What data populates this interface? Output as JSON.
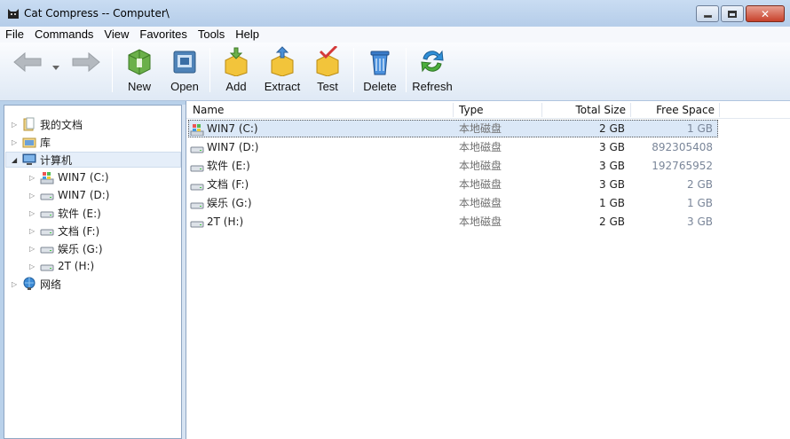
{
  "window": {
    "title": "Cat Compress -- Computer\\",
    "icons": {
      "app": "cat-icon",
      "minimize": "minimize-icon",
      "maximize": "maximize-icon",
      "close": "close-icon"
    }
  },
  "menu": [
    "File",
    "Commands",
    "View",
    "Favorites",
    "Tools",
    "Help"
  ],
  "toolbar": {
    "new_label": "New",
    "open_label": "Open",
    "add_label": "Add",
    "extract_label": "Extract",
    "test_label": "Test",
    "delete_label": "Delete",
    "refresh_label": "Refresh"
  },
  "tree": [
    {
      "label": "我的文档",
      "icon": "documents-folder-icon"
    },
    {
      "label": "库",
      "icon": "library-icon"
    },
    {
      "label": "计算机",
      "icon": "computer-icon",
      "expanded": true,
      "selected": true
    },
    {
      "label": "WIN7 (C:)",
      "icon": "system-drive-icon"
    },
    {
      "label": "WIN7 (D:)",
      "icon": "drive-icon"
    },
    {
      "label": "软件 (E:)",
      "icon": "drive-icon"
    },
    {
      "label": "文档 (F:)",
      "icon": "drive-icon"
    },
    {
      "label": "娱乐 (G:)",
      "icon": "drive-icon"
    },
    {
      "label": "2T (H:)",
      "icon": "drive-icon"
    },
    {
      "label": "网络",
      "icon": "network-icon"
    }
  ],
  "columns": {
    "name": "Name",
    "type": "Type",
    "total": "Total Size",
    "free": "Free Space"
  },
  "rows": [
    {
      "name": "WIN7 (C:)",
      "type": "本地磁盘",
      "total": "2 GB",
      "free": "1 GB",
      "selected": true,
      "icon": "system-drive-icon"
    },
    {
      "name": "WIN7 (D:)",
      "type": "本地磁盘",
      "total": "3 GB",
      "free": "892305408",
      "icon": "drive-icon"
    },
    {
      "name": "软件 (E:)",
      "type": "本地磁盘",
      "total": "3 GB",
      "free": "192765952",
      "icon": "drive-icon"
    },
    {
      "name": "文档 (F:)",
      "type": "本地磁盘",
      "total": "3 GB",
      "free": "2 GB",
      "icon": "drive-icon"
    },
    {
      "name": "娱乐 (G:)",
      "type": "本地磁盘",
      "total": "1 GB",
      "free": "1 GB",
      "icon": "drive-icon"
    },
    {
      "name": "2T (H:)",
      "type": "本地磁盘",
      "total": "2 GB",
      "free": "3 GB",
      "icon": "drive-icon"
    }
  ]
}
